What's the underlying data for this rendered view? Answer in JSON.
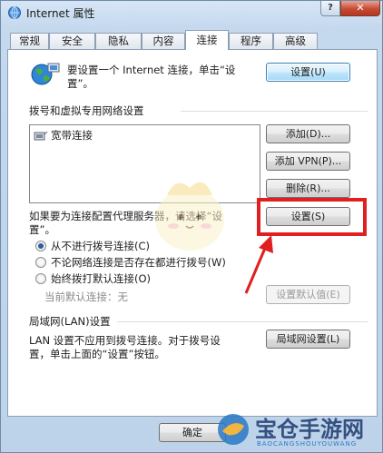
{
  "window": {
    "title": "Internet 属性",
    "help_label": "?",
    "close_label": "✕"
  },
  "tabs": [
    "常规",
    "安全",
    "隐私",
    "内容",
    "连接",
    "程序",
    "高级"
  ],
  "active_tab": "连接",
  "setup": {
    "text_line1": "要设置一个 Internet 连接，单击“设",
    "text_line2": "置”。",
    "button": "设置(U)"
  },
  "dialup": {
    "heading": "拨号和虚拟专用网络设置",
    "connections": [
      "宽带连接"
    ],
    "add_button": "添加(D)...",
    "add_vpn_button": "添加 VPN(P)...",
    "remove_button": "删除(R)...",
    "proxy_text_line1": "如果要为连接配置代理服务器，请选择“设",
    "proxy_text_line2": "置”。",
    "settings_button": "设置(S)",
    "options": [
      {
        "label": "从不进行拨号连接(C)",
        "selected": true
      },
      {
        "label": "不论网络连接是否存在都进行拨号(W)",
        "selected": false
      },
      {
        "label": "始终拨打默认连接(O)",
        "selected": false
      }
    ],
    "current_default_label": "当前默认连接：无",
    "set_default_button": "设置默认值(E)"
  },
  "lan": {
    "heading": "局域网(LAN)设置",
    "text_line1": "LAN 设置不应用到拨号连接。对于拨号设",
    "text_line2": "置，单击上面的“设置”按钮。",
    "button": "局域网设置(L)"
  },
  "footer": {
    "ok_button": "确定"
  },
  "watermark": {
    "text": "宝仓手游网",
    "sub": "BAOCANGSHOUYOUWANG"
  },
  "colors": {
    "highlight": "#e02020",
    "accent": "#3c7fb1"
  }
}
